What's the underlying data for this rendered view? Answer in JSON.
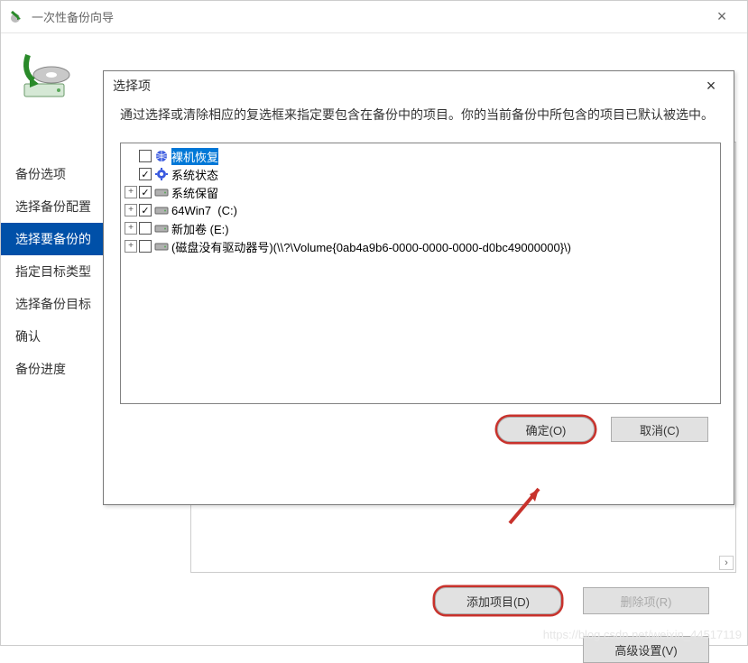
{
  "window": {
    "title": "一次性备份向导"
  },
  "sidebar": {
    "items": [
      {
        "label": "备份选项"
      },
      {
        "label": "选择备份配置"
      },
      {
        "label": "选择要备份的"
      },
      {
        "label": "指定目标类型"
      },
      {
        "label": "选择备份目标"
      },
      {
        "label": "确认"
      },
      {
        "label": "备份进度"
      }
    ]
  },
  "content_buttons": {
    "add": "添加项目(D)",
    "remove": "删除项(R)",
    "advanced": "高级设置(V)"
  },
  "dialog": {
    "title": "选择项",
    "description": "通过选择或清除相应的复选框来指定要包含在备份中的项目。你的当前备份中所包含的项目已默认被选中。",
    "ok": "确定(O)",
    "cancel": "取消(C)",
    "tree": [
      {
        "expander": "",
        "checked": false,
        "icon": "globe",
        "label": "裸机恢复",
        "selected": true
      },
      {
        "expander": "",
        "checked": true,
        "icon": "gear",
        "label": "系统状态"
      },
      {
        "expander": "+",
        "checked": true,
        "icon": "drive",
        "label": "系统保留"
      },
      {
        "expander": "+",
        "checked": true,
        "icon": "drive",
        "label": "64Win7  (C:)"
      },
      {
        "expander": "+",
        "checked": false,
        "icon": "drive",
        "label": "新加卷 (E:)"
      },
      {
        "expander": "+",
        "checked": false,
        "icon": "drive",
        "label": "(磁盘没有驱动器号)(\\\\?\\Volume{0ab4a9b6-0000-0000-0000-d0bc49000000}\\)"
      }
    ]
  },
  "watermark": "https://blog.csdn.net/weixin_44517119"
}
